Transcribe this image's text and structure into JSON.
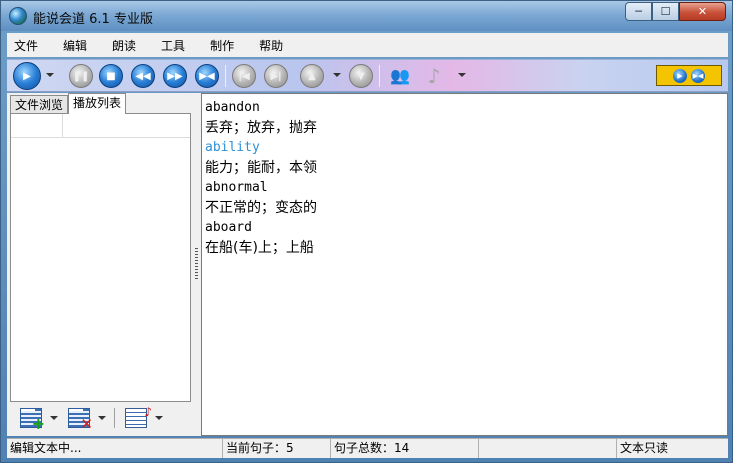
{
  "window": {
    "title": "能说会道 6.1 专业版",
    "controls": {
      "minimize": "─",
      "maximize": "☐",
      "close": "✕"
    }
  },
  "menu": {
    "items": [
      "文件",
      "编辑",
      "朗读",
      "工具",
      "制作",
      "帮助"
    ]
  },
  "toolbar": {
    "buttons": [
      {
        "name": "play",
        "icon": "play-icon"
      },
      {
        "name": "pause",
        "icon": "pause-icon"
      },
      {
        "name": "stop",
        "icon": "stop-icon"
      },
      {
        "name": "rewind",
        "icon": "rewind-icon"
      },
      {
        "name": "fast-forward",
        "icon": "fast-forward-icon"
      },
      {
        "name": "repeat",
        "icon": "repeat-icon"
      },
      {
        "name": "first",
        "icon": "skip-first-icon"
      },
      {
        "name": "last",
        "icon": "skip-last-icon"
      },
      {
        "name": "eject",
        "icon": "eject-icon"
      },
      {
        "name": "down",
        "icon": "down-icon"
      },
      {
        "name": "users",
        "icon": "users-icon"
      },
      {
        "name": "music",
        "icon": "music-note-icon"
      }
    ],
    "accent_color": "#f5c400"
  },
  "leftpanel": {
    "tabs": [
      "文件浏览",
      "播放列表"
    ],
    "active_tab": "播放列表"
  },
  "content": {
    "lines": [
      {
        "text": "abandon",
        "lang": "en",
        "highlight": false
      },
      {
        "text": "丢弃；放弃，抛弃",
        "lang": "zh",
        "highlight": false
      },
      {
        "text": "ability",
        "lang": "en",
        "highlight": true
      },
      {
        "text": "能力；能耐，本领",
        "lang": "zh",
        "highlight": false
      },
      {
        "text": "abnormal",
        "lang": "en",
        "highlight": false
      },
      {
        "text": "不正常的；变态的",
        "lang": "zh",
        "highlight": false
      },
      {
        "text": "aboard",
        "lang": "en",
        "highlight": false
      },
      {
        "text": "在船(车)上；上船",
        "lang": "zh",
        "highlight": false
      }
    ],
    "highlight_color": "#2f8fd6"
  },
  "status": {
    "mode": "编辑文本中...",
    "current_sentence": "当前句子：5",
    "total_sentences": "句子总数：14",
    "empty": "",
    "readonly": "文本只读"
  }
}
